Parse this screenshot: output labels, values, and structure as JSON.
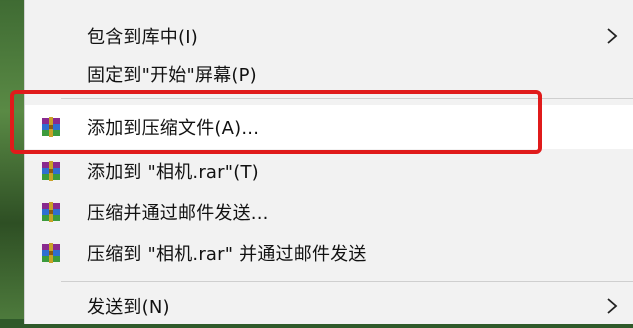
{
  "context_menu": {
    "items": [
      {
        "label": "包含到库中(I)",
        "has_submenu": true
      },
      {
        "label": "固定到\"开始\"屏幕(P)",
        "has_submenu": false
      },
      {
        "label": "添加到压缩文件(A)...",
        "icon": "winrar-icon",
        "hover": true
      },
      {
        "label": "添加到 \"相机.rar\"(T)",
        "icon": "winrar-icon"
      },
      {
        "label": "压缩并通过邮件发送...",
        "icon": "winrar-icon"
      },
      {
        "label": "压缩到 \"相机.rar\" 并通过邮件发送",
        "icon": "winrar-icon"
      },
      {
        "label": "发送到(N)",
        "has_submenu": true
      }
    ]
  },
  "annotation": {
    "color": "#e01b1b"
  }
}
